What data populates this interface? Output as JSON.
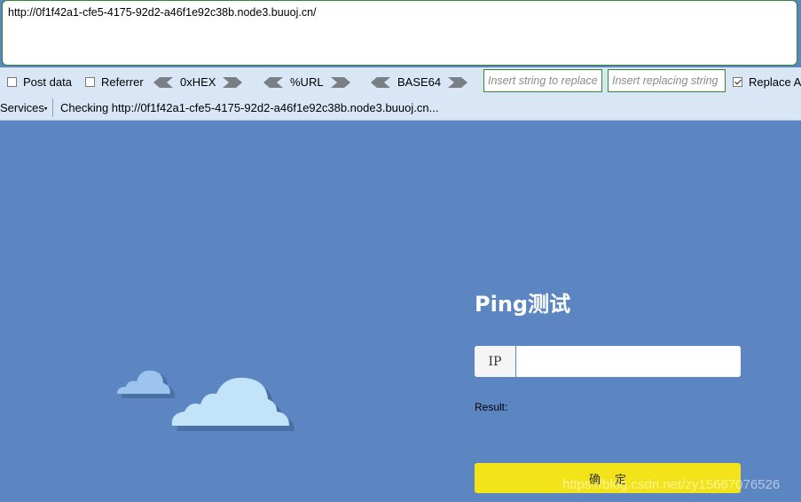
{
  "url_bar": {
    "url": "http://0f1f42a1-cfe5-4175-92d2-a46f1e92c38b.node3.buuoj.cn/"
  },
  "toolbar": {
    "post_data_label": "Post data",
    "referrer_label": "Referrer",
    "hex_label": "0xHEX",
    "url_label": "%URL",
    "base64_label": "BASE64",
    "replace_input_placeholder": "Insert string to replace",
    "replacing_input_placeholder": "Insert replacing string",
    "replace_all_label": "Replace A",
    "replace_all_checked": true,
    "accent_color": "#2f8a2f"
  },
  "statusbar": {
    "services_label": "Services",
    "status_text": "Checking http://0f1f42a1-cfe5-4175-92d2-a46f1e92c38b.node3.buuoj.cn..."
  },
  "page": {
    "background_color": "#5b86c1",
    "title": "Ping测试",
    "ip_label": "IP",
    "ip_value": "",
    "result_label": "Result:",
    "confirm_label": "确定",
    "confirm_color": "#f3e41a",
    "watermark": "https://blog.csdn.net/zy15667076526"
  },
  "icons": [
    "left-arrow-icon",
    "right-arrow-icon",
    "cloud-icon"
  ]
}
